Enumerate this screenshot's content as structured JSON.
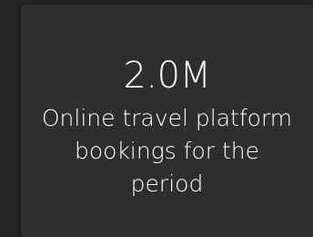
{
  "kpi_card": {
    "value": "2.0M",
    "label": "Online travel platform bookings for the period"
  }
}
